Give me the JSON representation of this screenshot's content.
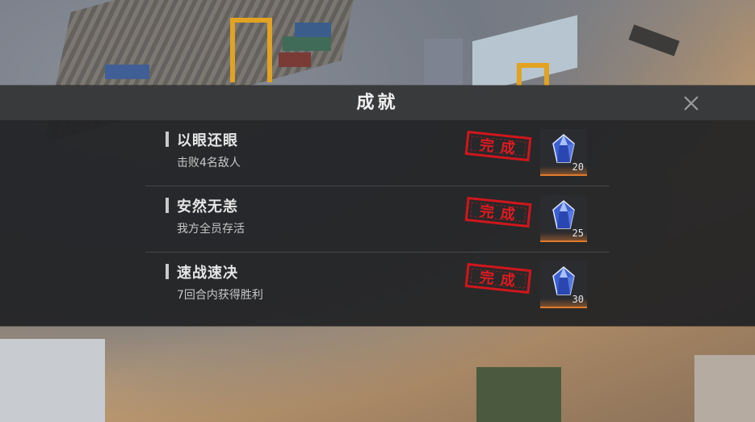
{
  "dialog": {
    "title": "成就"
  },
  "achievements": [
    {
      "name": "以眼还眼",
      "description": "击败4名敌人",
      "status": "完成",
      "reward_icon": "crystal-gem-icon",
      "reward_count": "20"
    },
    {
      "name": "安然无恙",
      "description": "我方全员存活",
      "status": "完成",
      "reward_icon": "crystal-gem-icon",
      "reward_count": "25"
    },
    {
      "name": "速战速决",
      "description": "7回合内获得胜利",
      "status": "完成",
      "reward_icon": "crystal-gem-icon",
      "reward_count": "30"
    }
  ],
  "colors": {
    "stamp": "#d0161c",
    "reward_accent": "#e07a2c",
    "gem": "#4a6ed6"
  }
}
